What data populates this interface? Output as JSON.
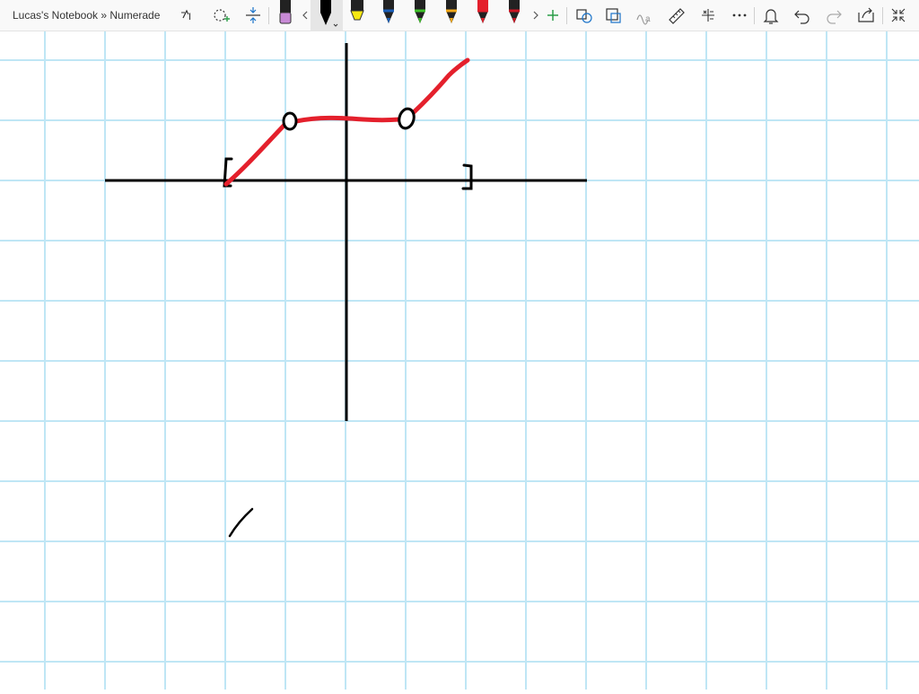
{
  "window": {
    "title": "Lucas's Notebook » Numerade"
  },
  "colors": {
    "grid": "#bfe6f5",
    "ink_black": "#000000",
    "ink_red": "#e4202c",
    "toolbar_bg": "#f9f9f9",
    "accent": "#1a73c9"
  },
  "toolbar": {
    "left_tools": [
      "lasso-select-icon",
      "add-shape-icon",
      "insert-space-icon"
    ],
    "pens": [
      {
        "name": "eraser",
        "color": "#c88ad6"
      },
      {
        "name": "black-pen",
        "color": "#000000",
        "selected": true
      },
      {
        "name": "yellow-highlighter",
        "color": "#f6e812"
      },
      {
        "name": "blue-pen",
        "color": "#1b5fb8"
      },
      {
        "name": "green-pen",
        "color": "#3ec129"
      },
      {
        "name": "orange-pen",
        "color": "#f2a818"
      },
      {
        "name": "red-glitter-pen",
        "color": "#e4202c"
      },
      {
        "name": "red-pen",
        "color": "#cc1422"
      }
    ],
    "right_tools": [
      "shapes-icon",
      "ink-to-shape-icon",
      "ink-to-text-icon",
      "ruler-icon",
      "math-icon",
      "more-icon",
      "bell-icon",
      "undo-icon",
      "redo-icon",
      "share-icon",
      "collapse-icon"
    ]
  },
  "drawing": {
    "axes": "black",
    "curve": "red piecewise function with open circles and closed endpoint brackets"
  }
}
